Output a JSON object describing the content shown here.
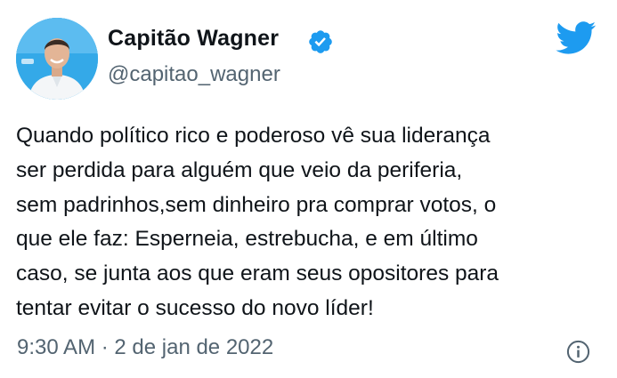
{
  "author": {
    "display_name": "Capitão Wagner",
    "handle": "@capitao_wagner",
    "verified": true,
    "avatar_icon": "profile-photo"
  },
  "tweet": {
    "text": "Quando político rico e poderoso vê sua liderança\nser perdida para alguém que veio da periferia,\nsem padrinhos,sem dinheiro pra comprar votos, o\nque ele faz: Esperneia, estrebucha, e em último\ncaso, se junta aos que eram seus opositores para\ntentar evitar o sucesso do novo líder!",
    "timestamp": "9:30 AM · 2 de jan de 2022"
  },
  "icons": {
    "verified": "verified-badge-icon",
    "brand": "twitter-bird-icon",
    "info": "info-icon"
  },
  "colors": {
    "brand": "#1d9bf0",
    "text": "#0f1419",
    "secondary": "#536471"
  }
}
